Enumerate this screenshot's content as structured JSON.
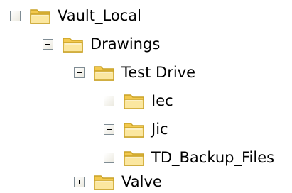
{
  "tree": {
    "nodes": [
      {
        "id": "vault-local",
        "label": "Vault_Local",
        "expanded": true,
        "level": 0,
        "icon": "folder-icon"
      },
      {
        "id": "drawings",
        "label": "Drawings",
        "expanded": true,
        "level": 1,
        "icon": "folder-icon"
      },
      {
        "id": "test-drive",
        "label": "Test Drive",
        "expanded": true,
        "level": 2,
        "icon": "folder-icon"
      },
      {
        "id": "iec",
        "label": "Iec",
        "expanded": false,
        "level": 3,
        "icon": "folder-icon"
      },
      {
        "id": "jic",
        "label": "Jic",
        "expanded": false,
        "level": 3,
        "icon": "folder-icon"
      },
      {
        "id": "td-backup-files",
        "label": "TD_Backup_Files",
        "expanded": false,
        "level": 3,
        "icon": "folder-icon"
      },
      {
        "id": "valve",
        "label": "Valve",
        "expanded": false,
        "level": 2,
        "icon": "folder-icon"
      }
    ]
  },
  "colors": {
    "folder_body": "#f7d65a",
    "folder_front": "#fbe88f",
    "folder_edge": "#c9a227",
    "toggle_border": "#7f8c94"
  }
}
